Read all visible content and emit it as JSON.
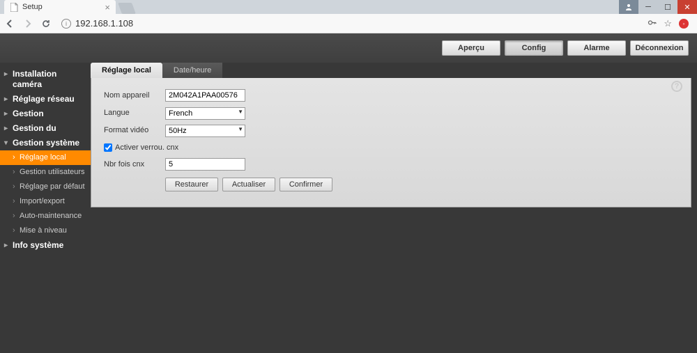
{
  "browser": {
    "tab_title": "Setup",
    "url": "192.168.1.108"
  },
  "header_nav": {
    "preview": "Aperçu",
    "config": "Config",
    "alarm": "Alarme",
    "logout": "Déconnexion"
  },
  "sidebar": {
    "items": [
      {
        "label": "Installation caméra"
      },
      {
        "label": "Réglage réseau"
      },
      {
        "label": "Gestion"
      },
      {
        "label": "Gestion du"
      },
      {
        "label": "Gestion système",
        "open": true,
        "children": [
          {
            "label": "Réglage local",
            "active": true
          },
          {
            "label": "Gestion utilisateurs"
          },
          {
            "label": "Réglage par défaut"
          },
          {
            "label": "Import/export"
          },
          {
            "label": "Auto-maintenance"
          },
          {
            "label": "Mise à niveau"
          }
        ]
      },
      {
        "label": "Info système"
      }
    ]
  },
  "content_tabs": {
    "local": "Réglage local",
    "datetime": "Date/heure"
  },
  "form": {
    "device_name_label": "Nom appareil",
    "device_name_value": "2M042A1PAA00576",
    "language_label": "Langue",
    "language_value": "French",
    "video_format_label": "Format vidéo",
    "video_format_value": "50Hz",
    "lock_enable_label": "Activer verrou. cnx",
    "lock_enable_checked": true,
    "lock_count_label": "Nbr fois cnx",
    "lock_count_value": "5",
    "buttons": {
      "restore": "Restaurer",
      "refresh": "Actualiser",
      "confirm": "Confirmer"
    }
  }
}
